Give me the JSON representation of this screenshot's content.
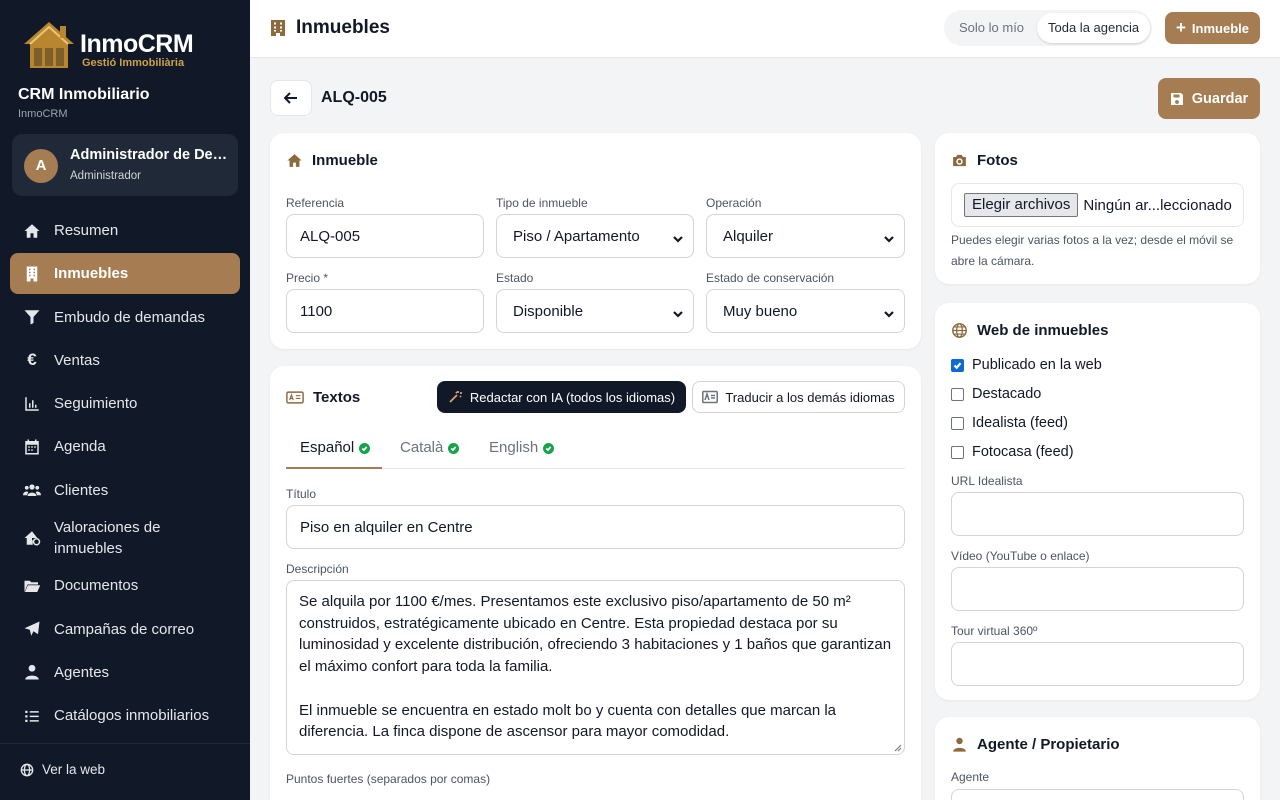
{
  "brand": {
    "logo_name": "InmoCRM",
    "logo_sub": "Gestió Immobiliària",
    "crm_title": "CRM Inmobiliario",
    "crm_sub": "InmoCRM",
    "accent": "#a67c52",
    "sidebar_bg": "#111827"
  },
  "user": {
    "initial": "A",
    "name": "Administrador de Demo",
    "role": "Administrador"
  },
  "sidebar": {
    "items": [
      {
        "label": "Resumen",
        "icon": "home-icon"
      },
      {
        "label": "Inmuebles",
        "icon": "building-icon",
        "active": true
      },
      {
        "label": "Embudo de demandas",
        "icon": "funnel-icon"
      },
      {
        "label": "Ventas",
        "icon": "euro-icon"
      },
      {
        "label": "Seguimiento",
        "icon": "chart-icon"
      },
      {
        "label": "Agenda",
        "icon": "calendar-icon"
      },
      {
        "label": "Clientes",
        "icon": "users-icon"
      },
      {
        "label": "Valoraciones de inmuebles",
        "icon": "house-valuation-icon"
      },
      {
        "label": "Documentos",
        "icon": "folder-icon"
      },
      {
        "label": "Campañas de correo",
        "icon": "paper-plane-icon"
      },
      {
        "label": "Agentes",
        "icon": "user-tie-icon"
      },
      {
        "label": "Catálogos inmobiliarios",
        "icon": "list-icon"
      }
    ],
    "footer_link": "Ver la web"
  },
  "topbar": {
    "title": "Inmuebles",
    "scope_mine": "Solo lo mío",
    "scope_all": "Toda la agencia",
    "new_button": "Inmueble"
  },
  "subheader": {
    "reference": "ALQ-005",
    "save_label": "Guardar"
  },
  "inmueble": {
    "title": "Inmueble",
    "referencia_label": "Referencia",
    "referencia_value": "ALQ-005",
    "tipo_label": "Tipo de inmueble",
    "tipo_value": "Piso / Apartamento",
    "operacion_label": "Operación",
    "operacion_value": "Alquiler",
    "precio_label": "Precio *",
    "precio_value": "1100",
    "estado_label": "Estado",
    "estado_value": "Disponible",
    "conservacion_label": "Estado de conservación",
    "conservacion_value": "Muy bueno"
  },
  "textos": {
    "title": "Textos",
    "ai_button": "Redactar con IA (todos los idiomas)",
    "translate_button": "Traducir a los demás idiomas",
    "tabs": [
      {
        "label": "Español",
        "done": true,
        "active": true
      },
      {
        "label": "Català",
        "done": true
      },
      {
        "label": "English",
        "done": true
      }
    ],
    "titulo_label": "Título",
    "titulo_value": "Piso en alquiler en Centre",
    "descripcion_label": "Descripción",
    "descripcion_p1": "Se alquila por 1100 €/mes. Presentamos este exclusivo piso/apartamento de 50 m² construidos, estratégicamente ubicado en Centre. Esta propiedad destaca por su luminosidad y excelente distribución, ofreciendo 3 habitaciones y 1 baños que garantizan el máximo confort para toda la familia.",
    "descripcion_p2": "El inmueble se encuentra en estado molt bo y cuenta con detalles que marcan la diferencia. La finca dispone de ascensor para mayor comodidad.",
    "puntos_label": "Puntos fuertes (separados por comas)"
  },
  "fotos": {
    "title": "Fotos",
    "file_button": "Elegir archivos",
    "file_status": "Ningún ar...leccionado",
    "help": "Puedes elegir varias fotos a la vez; desde el móvil se abre la cámara."
  },
  "web": {
    "title": "Web de inmuebles",
    "checks": [
      {
        "label": "Publicado en la web",
        "checked": true
      },
      {
        "label": "Destacado",
        "checked": false
      },
      {
        "label": "Idealista (feed)",
        "checked": false
      },
      {
        "label": "Fotocasa (feed)",
        "checked": false
      }
    ],
    "url_idealista_label": "URL Idealista",
    "video_label": "Vídeo (YouTube o enlace)",
    "tour_label": "Tour virtual 360º"
  },
  "agente": {
    "title": "Agente / Propietario",
    "agente_label": "Agente"
  }
}
